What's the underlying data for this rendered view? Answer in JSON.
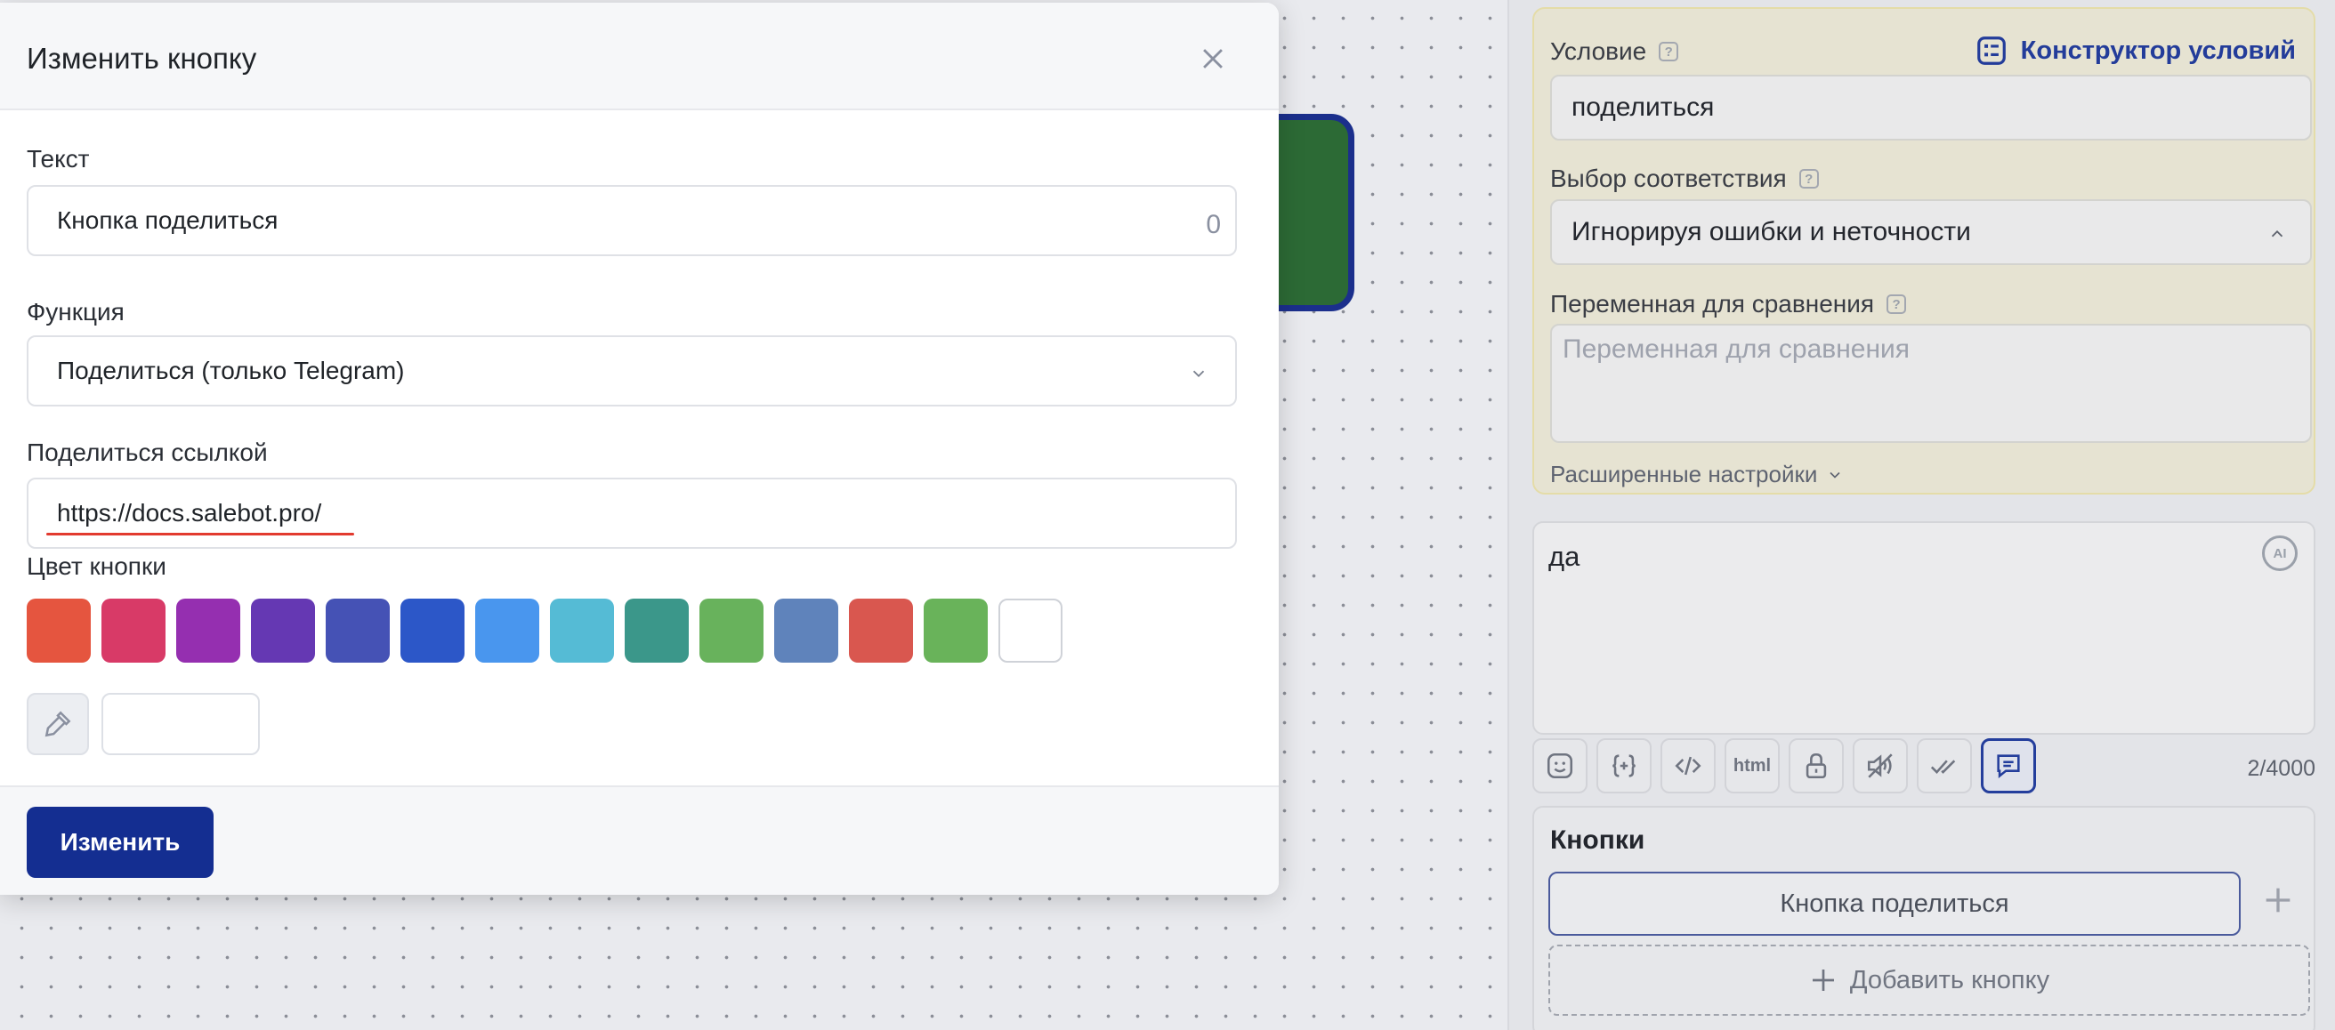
{
  "modal": {
    "title": "Изменить кнопку",
    "text_label": "Текст",
    "text_value": "Кнопка поделиться",
    "text_counter": "0",
    "function_label": "Функция",
    "function_value": "Поделиться (только Telegram)",
    "share_label": "Поделиться ссылкой",
    "share_value": "https://docs.salebot.pro/",
    "color_label": "Цвет кнопки",
    "colors": [
      "#e5553f",
      "#d83a67",
      "#952fb0",
      "#6538b3",
      "#4552b5",
      "#2c57c8",
      "#4996ee",
      "#55bbd5",
      "#3b978a",
      "#68b25c",
      "#5f83bb",
      "#d9574f",
      "#69b35a",
      "#ffffff"
    ],
    "hex_value": "",
    "submit_label": "Изменить"
  },
  "panel": {
    "condition_label": "Условие",
    "constructor_label": "Конструктор условий",
    "condition_value": "поделиться",
    "match_label": "Выбор соответствия",
    "match_value": "Игнорируя ошибки и неточности",
    "compare_label": "Переменная для сравнения",
    "compare_placeholder": "Переменная для сравнения",
    "advanced_label": "Расширенные настройки",
    "message_text": "да",
    "ai_label": "AI",
    "html_label": "html",
    "char_count": "2/4000",
    "buttons_title": "Кнопки",
    "button_item": "Кнопка поделиться",
    "add_button_label": "Добавить кнопку"
  },
  "theme": {
    "primary": "#142e91",
    "accent": "#233c9a",
    "node_color": "#2c6a35"
  }
}
